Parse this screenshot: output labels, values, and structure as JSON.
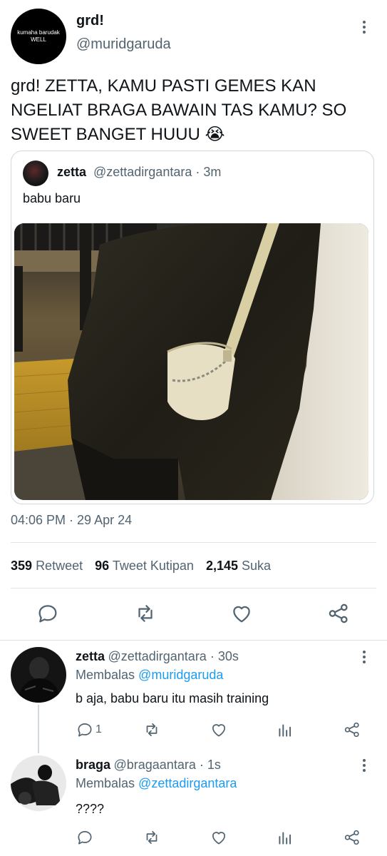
{
  "main_tweet": {
    "avatar_text_line1": "kumaha barudak",
    "avatar_text_line2": "WELL",
    "display_name": "grd!",
    "handle": "@muridgaruda",
    "text": "grd! ZETTA, KAMU PASTI GEMES KAN\nNGELIAT BRAGA BAWAIN TAS KAMU? SO\nSWEET BANGET HUUU 😭",
    "timestamp": "04:06 PM · 29 Apr 24"
  },
  "quoted_tweet": {
    "display_name": "zetta",
    "handle_time": "@zettadirgantara · 3m",
    "text": "babu baru"
  },
  "stats": {
    "retweets": "359",
    "retweets_label": "Retweet",
    "quotes": "96",
    "quotes_label": "Tweet Kutipan",
    "likes": "2,145",
    "likes_label": "Suka"
  },
  "actions": [
    "reply-icon",
    "retweet-icon",
    "like-icon",
    "share-icon"
  ],
  "replies": [
    {
      "display_name": "zetta",
      "handle_time": "@zettadirgantara · 30s",
      "replying_prefix": "Membalas",
      "replying_to": "@muridgaruda",
      "text": "b aja, babu baru itu masih training",
      "reply_count": "1"
    },
    {
      "display_name": "braga",
      "handle_time": "@bragaantara · 1s",
      "replying_prefix": "Membalas",
      "replying_to": "@zettadirgantara",
      "text": "????"
    }
  ],
  "colors": {
    "link": "#1d9bf0",
    "muted": "#536471",
    "divider": "#dfe4e8"
  }
}
